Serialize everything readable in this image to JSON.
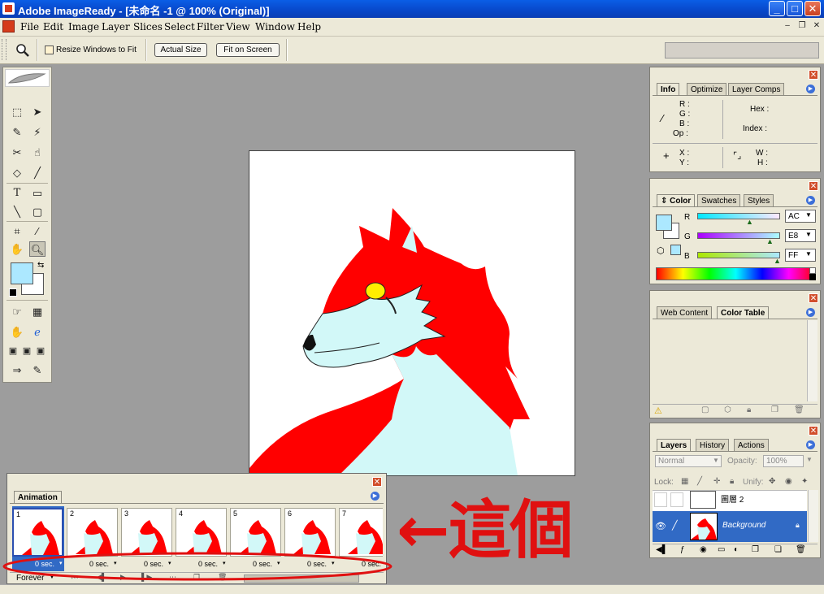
{
  "window": {
    "title": "Adobe ImageReady - [未命名 -1 @ 100% (Original)]",
    "minimize": "_",
    "maximize": "□",
    "close": "✕"
  },
  "menu": [
    "File",
    "Edit",
    "Image",
    "Layer",
    "Slices",
    "Select",
    "Filter",
    "View",
    "Window",
    "Help"
  ],
  "options_bar": {
    "resize_windows_label": "Resize Windows to Fit",
    "actual_size": "Actual Size",
    "fit_on_screen": "Fit on Screen"
  },
  "info_panel": {
    "tabs": [
      "Info",
      "Optimize",
      "Layer Comps"
    ],
    "r": "R :",
    "g": "G :",
    "b": "B :",
    "op": "Op :",
    "hex": "Hex :",
    "index": "Index :",
    "x": "X :",
    "y": "Y :",
    "w": "W :",
    "h": "H :"
  },
  "color_panel": {
    "tabs": [
      "Color",
      "Swatches",
      "Styles"
    ],
    "channels": [
      {
        "label": "R",
        "value": "AC",
        "level": 0.67
      },
      {
        "label": "G",
        "value": "E8",
        "level": 0.91
      },
      {
        "label": "B",
        "value": "FF",
        "level": 1.0
      }
    ],
    "foreground": "#ace8ff"
  },
  "webcontent_panel": {
    "tabs": [
      "Web Content",
      "Color Table"
    ]
  },
  "layers_panel": {
    "tabs": [
      "Layers",
      "History",
      "Actions"
    ],
    "blend_mode": "Normal",
    "opacity_label": "Opacity:",
    "opacity_value": "100%",
    "lock_label": "Lock:",
    "unify_label": "Unify:",
    "layers": [
      {
        "name": "圖層 2",
        "selected": false
      },
      {
        "name": "Background",
        "selected": true
      }
    ]
  },
  "animation_panel": {
    "title": "Animation",
    "frames": [
      {
        "num": "1",
        "delay": "0 sec."
      },
      {
        "num": "2",
        "delay": "0 sec."
      },
      {
        "num": "3",
        "delay": "0 sec."
      },
      {
        "num": "4",
        "delay": "0 sec."
      },
      {
        "num": "5",
        "delay": "0 sec."
      },
      {
        "num": "6",
        "delay": "0 sec."
      },
      {
        "num": "7",
        "delay": "0 sec."
      }
    ],
    "loop": "Forever"
  },
  "annotation": {
    "text": "←這個",
    "color": "#e01010"
  },
  "colors": {
    "titlebar": "#0a5ee6",
    "chrome": "#ece9d8",
    "workspace": "#9d9d9d",
    "wolf_red": "#ff0000",
    "wolf_light": "#d2f8f8"
  }
}
